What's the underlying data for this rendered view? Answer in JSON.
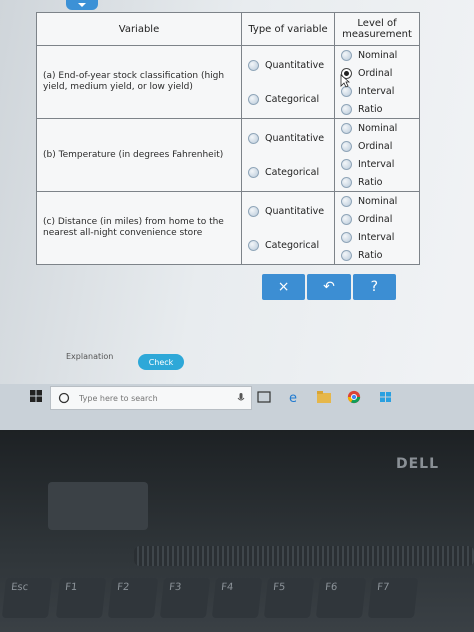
{
  "table": {
    "headers": {
      "variable": "Variable",
      "type": "Type of variable",
      "level": "Level of measurement"
    },
    "rows": [
      {
        "label": "(a) End-of-year stock classification (high yield, medium yield, or low yield)",
        "types": [
          "Quantitative",
          "Categorical"
        ],
        "levels": [
          "Nominal",
          "Ordinal",
          "Interval",
          "Ratio"
        ],
        "selected_level": "Ordinal"
      },
      {
        "label": "(b) Temperature (in degrees Fahrenheit)",
        "types": [
          "Quantitative",
          "Categorical"
        ],
        "levels": [
          "Nominal",
          "Ordinal",
          "Interval",
          "Ratio"
        ]
      },
      {
        "label": "(c) Distance (in miles) from home to the nearest all-night convenience store",
        "types": [
          "Quantitative",
          "Categorical"
        ],
        "levels": [
          "Nominal",
          "Ordinal",
          "Interval",
          "Ratio"
        ]
      }
    ]
  },
  "actions": {
    "clear": "×",
    "undo": "↶",
    "help": "?"
  },
  "explanation_label": "Explanation",
  "check_label": "Check",
  "taskbar": {
    "search_placeholder": "Type here to search"
  },
  "laptop": {
    "brand": "DELL",
    "keys": [
      "Esc",
      "F1",
      "F2",
      "F3",
      "F4",
      "F5",
      "F6",
      "F7"
    ]
  },
  "colors": {
    "accent": "#3c8ed3",
    "check": "#2ea8d8"
  }
}
